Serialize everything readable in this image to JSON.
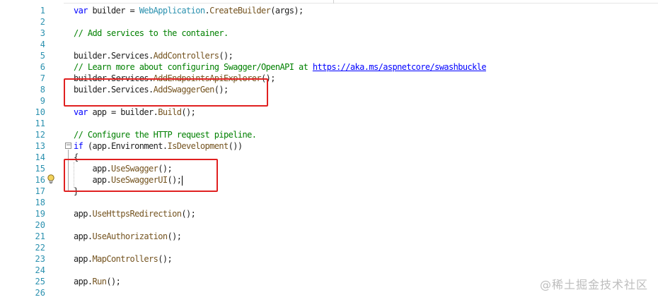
{
  "editor": {
    "line_numbers": [
      "1",
      "2",
      "3",
      "4",
      "5",
      "6",
      "7",
      "8",
      "9",
      "10",
      "11",
      "12",
      "13",
      "14",
      "15",
      "16",
      "17",
      "18",
      "19",
      "20",
      "21",
      "22",
      "23",
      "24",
      "25",
      "26"
    ],
    "code_lines": [
      [
        {
          "t": "var",
          "c": "kw"
        },
        {
          "t": " builder = ",
          "c": "plain"
        },
        {
          "t": "WebApplication",
          "c": "type"
        },
        {
          "t": ".",
          "c": "plain"
        },
        {
          "t": "CreateBuilder",
          "c": "method"
        },
        {
          "t": "(args);",
          "c": "plain"
        }
      ],
      [],
      [
        {
          "t": "// Add services to the container.",
          "c": "comment"
        }
      ],
      [],
      [
        {
          "t": "builder.Services.",
          "c": "plain"
        },
        {
          "t": "AddControllers",
          "c": "method"
        },
        {
          "t": "();",
          "c": "plain"
        }
      ],
      [
        {
          "t": "// Learn more about configuring Swagger/OpenAPI at ",
          "c": "comment"
        },
        {
          "t": "https://aka.ms/aspnetcore/swashbuckle",
          "c": "link"
        }
      ],
      [
        {
          "t": "builder.Services.",
          "c": "plain"
        },
        {
          "t": "AddEndpointsApiExplorer",
          "c": "method"
        },
        {
          "t": "();",
          "c": "plain"
        }
      ],
      [
        {
          "t": "builder.Services.",
          "c": "plain"
        },
        {
          "t": "AddSwaggerGen",
          "c": "method"
        },
        {
          "t": "();",
          "c": "plain"
        }
      ],
      [],
      [
        {
          "t": "var",
          "c": "kw"
        },
        {
          "t": " app = builder.",
          "c": "plain"
        },
        {
          "t": "Build",
          "c": "method"
        },
        {
          "t": "();",
          "c": "plain"
        }
      ],
      [],
      [
        {
          "t": "// Configure the HTTP request pipeline.",
          "c": "comment"
        }
      ],
      [
        {
          "t": "if",
          "c": "kw"
        },
        {
          "t": " (app.Environment.",
          "c": "plain"
        },
        {
          "t": "IsDevelopment",
          "c": "method"
        },
        {
          "t": "())",
          "c": "plain"
        }
      ],
      [
        {
          "t": "{",
          "c": "plain"
        }
      ],
      [
        {
          "t": "    app.",
          "c": "plain"
        },
        {
          "t": "UseSwagger",
          "c": "method"
        },
        {
          "t": "();",
          "c": "plain"
        }
      ],
      [
        {
          "t": "    app.",
          "c": "plain"
        },
        {
          "t": "UseSwaggerUI",
          "c": "method"
        },
        {
          "t": "();",
          "c": "plain"
        }
      ],
      [
        {
          "t": "}",
          "c": "plain"
        }
      ],
      [],
      [
        {
          "t": "app.",
          "c": "plain"
        },
        {
          "t": "UseHttpsRedirection",
          "c": "method"
        },
        {
          "t": "();",
          "c": "plain"
        }
      ],
      [],
      [
        {
          "t": "app.",
          "c": "plain"
        },
        {
          "t": "UseAuthorization",
          "c": "method"
        },
        {
          "t": "();",
          "c": "plain"
        }
      ],
      [],
      [
        {
          "t": "app.",
          "c": "plain"
        },
        {
          "t": "MapControllers",
          "c": "method"
        },
        {
          "t": "();",
          "c": "plain"
        }
      ],
      [],
      [
        {
          "t": "app.",
          "c": "plain"
        },
        {
          "t": "Run",
          "c": "method"
        },
        {
          "t": "();",
          "c": "plain"
        }
      ],
      []
    ],
    "fold_symbol": "−",
    "caret_line": 16
  },
  "watermark": {
    "text": "@稀土掘金技术社区"
  },
  "colors": {
    "highlight": "#e02020",
    "line_number": "#2b91af",
    "keyword": "#0000ff",
    "comment": "#008000"
  }
}
